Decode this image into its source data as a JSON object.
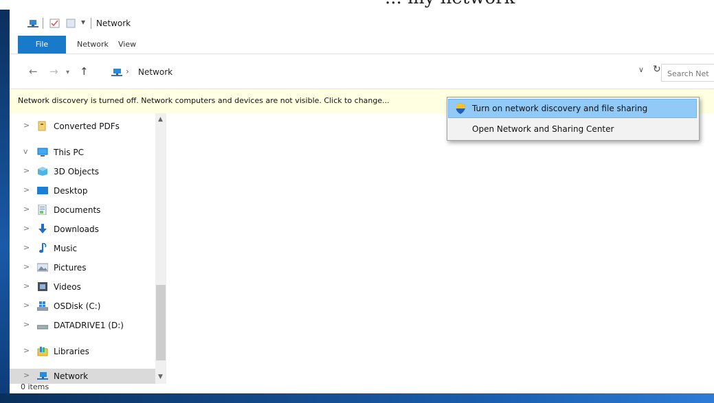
{
  "window": {
    "title": "Network"
  },
  "ribbon": {
    "tabs": [
      "File",
      "Network",
      "View"
    ]
  },
  "address": {
    "path": "Network",
    "search_placeholder": "Search Net"
  },
  "infobar": {
    "message": "Network discovery is turned off. Network computers and devices are not visible. Click to change..."
  },
  "nav": {
    "items": [
      {
        "label": "Converted PDFs",
        "icon": "folder-icon",
        "expander": ">"
      },
      {
        "label": "This PC",
        "icon": "pc-icon",
        "expander": "v"
      },
      {
        "label": "3D Objects",
        "icon": "cube-icon",
        "expander": ">"
      },
      {
        "label": "Desktop",
        "icon": "desktop-icon",
        "expander": ">"
      },
      {
        "label": "Documents",
        "icon": "documents-icon",
        "expander": ">"
      },
      {
        "label": "Downloads",
        "icon": "download-icon",
        "expander": ">"
      },
      {
        "label": "Music",
        "icon": "music-icon",
        "expander": ">"
      },
      {
        "label": "Pictures",
        "icon": "pictures-icon",
        "expander": ">"
      },
      {
        "label": "Videos",
        "icon": "videos-icon",
        "expander": ">"
      },
      {
        "label": "OSDisk (C:)",
        "icon": "os-drive-icon",
        "expander": ">"
      },
      {
        "label": "DATADRIVE1 (D:)",
        "icon": "drive-icon",
        "expander": ">"
      },
      {
        "label": "Libraries",
        "icon": "libraries-icon",
        "expander": ">"
      },
      {
        "label": "Network",
        "icon": "network-icon",
        "expander": ">",
        "selected": true
      }
    ]
  },
  "status": {
    "item_count": "0 items"
  },
  "context_menu": {
    "items": [
      {
        "label": "Turn on network discovery and file sharing",
        "icon": "uac-shield-icon",
        "highlighted": true
      },
      {
        "label": "Open Network and Sharing Center"
      }
    ]
  },
  "colors": {
    "file_tab": "#1979ca",
    "infobar_bg": "#ffffe1",
    "menu_highlight": "#91c9f7",
    "desktop_bg": "#0e3f7a"
  }
}
